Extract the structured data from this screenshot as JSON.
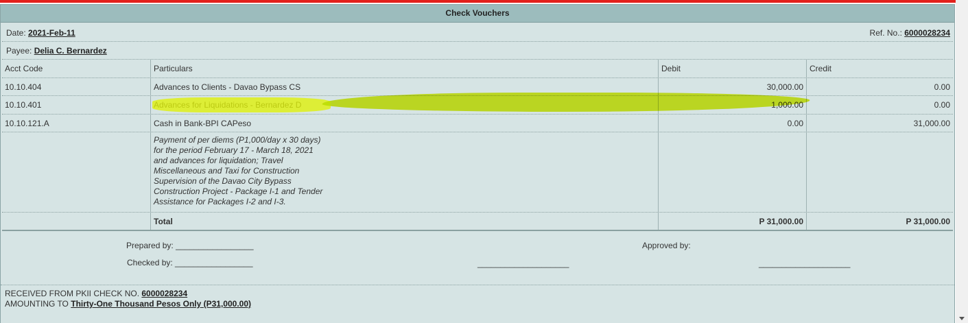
{
  "title": "Check Vouchers",
  "header": {
    "date_label": "Date:",
    "date_value": "2021-Feb-11",
    "ref_label": "Ref. No.:",
    "ref_value": "6000028234",
    "payee_label": "Payee:",
    "payee_value": "Delia C. Bernardez"
  },
  "columns": {
    "acct": "Acct Code",
    "particulars": "Particulars",
    "debit": "Debit",
    "credit": "Credit"
  },
  "rows": [
    {
      "acct": "10.10.404",
      "particulars": "Advances to Clients - Davao Bypass CS",
      "debit": "30,000.00",
      "credit": "0.00"
    },
    {
      "acct": "10.10.401",
      "particulars": "Advances for Liquidations - Bernardez D",
      "debit": "1,000.00",
      "credit": "0.00"
    },
    {
      "acct": "10.10.121.A",
      "particulars": "Cash in Bank-BPI CAPeso",
      "debit": "0.00",
      "credit": "31,000.00"
    }
  ],
  "description_lines": [
    "Payment of per diems (P1,000/day x 30 days)",
    "for the period February 17 - March 18, 2021",
    "and advances for liquidation; Travel",
    "Miscellaneous and Taxi for Construction",
    "Supervision of the Davao City Bypass",
    "Construction Project - Package I-1 and Tender",
    "Assistance for Packages I-2 and I-3."
  ],
  "total": {
    "label": "Total",
    "debit": "P 31,000.00",
    "credit": "P 31,000.00"
  },
  "signatures": {
    "prepared_by": "Prepared by:",
    "checked_by": "Checked by:",
    "approved_by": "Approved by:",
    "blank_short": "_________________",
    "blank_long": "____________________"
  },
  "receipt": {
    "line1_prefix": "RECEIVED FROM PKII CHECK NO.",
    "check_no": "6000028234",
    "line2_prefix": "AMOUNTING TO",
    "amount_words": "Thirty-One Thousand Pesos Only (P31,000.00)"
  },
  "colors": {
    "highlight": "#d8ec00",
    "accent_line": "#e2211c",
    "panel": "#d6e4e4",
    "titlebar": "#9cbcbd"
  }
}
